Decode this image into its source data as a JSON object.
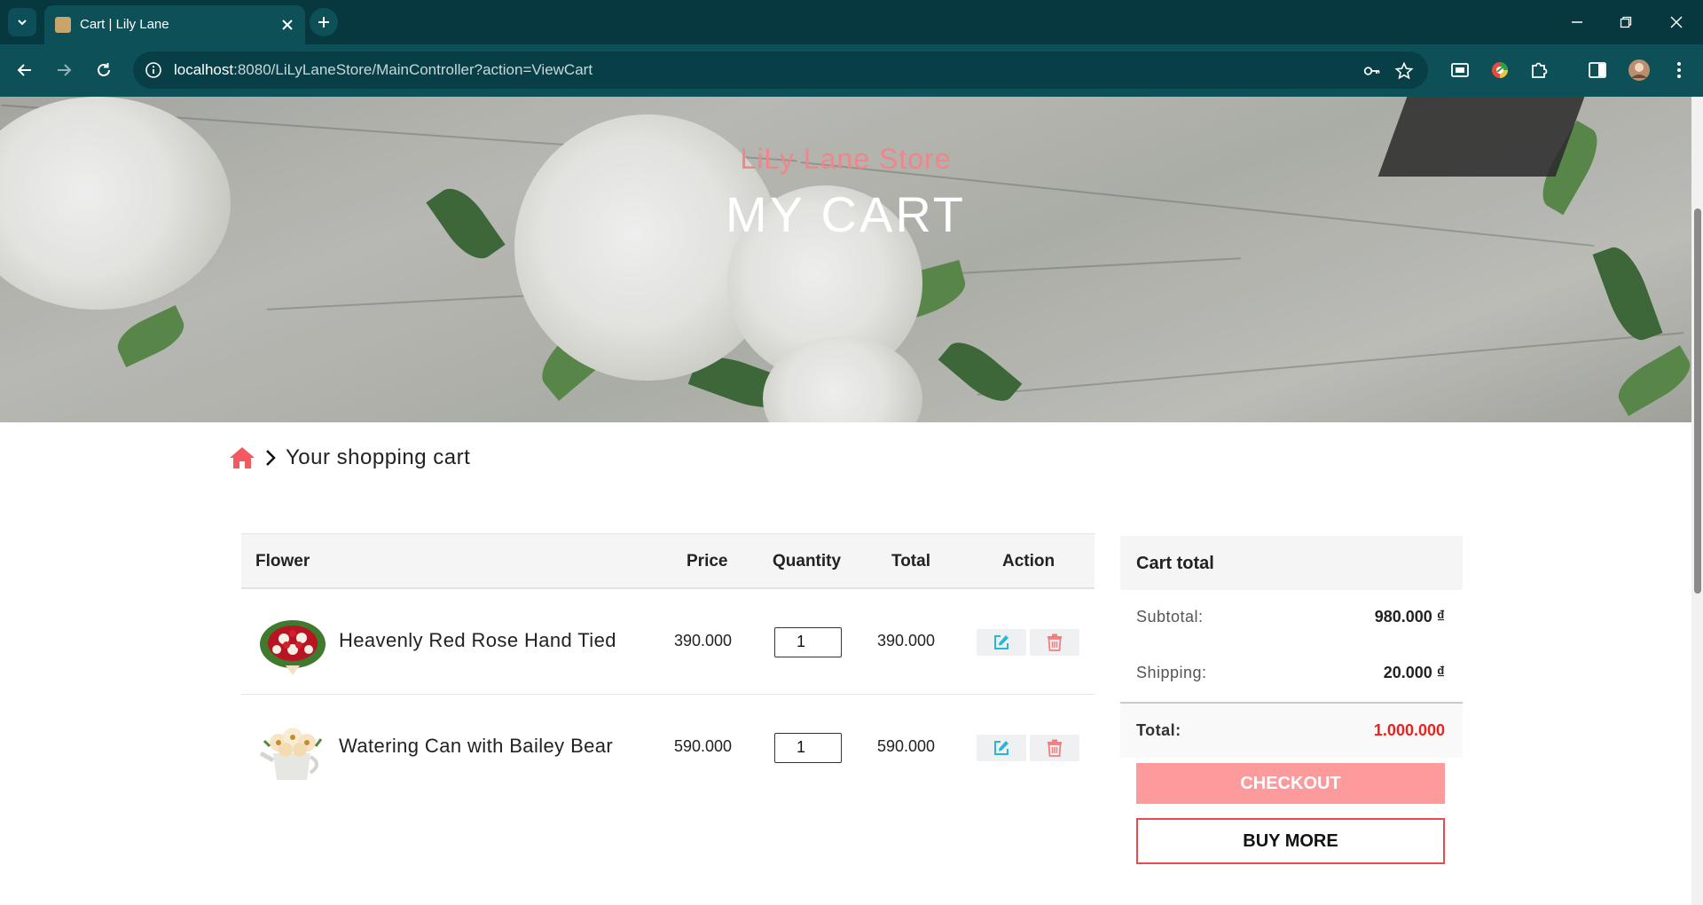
{
  "browser": {
    "tab_title": "Cart | Lily Lane",
    "url_host": "localhost",
    "url_rest": ":8080/LiLyLaneStore/MainController?action=ViewCart"
  },
  "hero": {
    "store_name": "LiLy Lane Store",
    "page_title": "MY CART"
  },
  "breadcrumb": {
    "current": "Your shopping cart"
  },
  "cart_table": {
    "headers": {
      "flower": "Flower",
      "price": "Price",
      "quantity": "Quantity",
      "total": "Total",
      "action": "Action"
    },
    "rows": [
      {
        "name": "Heavenly Red Rose Hand Tied",
        "price": "390.000",
        "quantity": "1",
        "total": "390.000"
      },
      {
        "name": "Watering Can with Bailey Bear",
        "price": "590.000",
        "quantity": "1",
        "total": "590.000"
      }
    ]
  },
  "cart_total": {
    "title": "Cart total",
    "subtotal_label": "Subtotal:",
    "subtotal_value": "980.000 ₫",
    "shipping_label": "Shipping:",
    "shipping_value": "20.000 ₫",
    "total_label": "Total:",
    "total_value": "1.000.000",
    "checkout_label": "CHECKOUT",
    "buy_more_label": "BUY MORE"
  },
  "colors": {
    "chrome_dark": "#07373f",
    "chrome_toolbar": "#0e5058",
    "accent_pink": "#f0868a",
    "checkout_bg": "#fc9a9c",
    "total_red": "#e8241f",
    "edit_icon": "#29b6d6",
    "delete_icon": "#f08080"
  },
  "icons": {
    "tab_search": "chevron-down-icon",
    "new_tab": "plus-icon",
    "back": "arrow-left-icon",
    "forward": "arrow-right-icon",
    "reload": "reload-icon",
    "site_info": "info-icon",
    "password": "key-icon",
    "bookmark": "star-icon",
    "home": "home-icon",
    "edit": "edit-icon",
    "delete": "trash-icon"
  }
}
